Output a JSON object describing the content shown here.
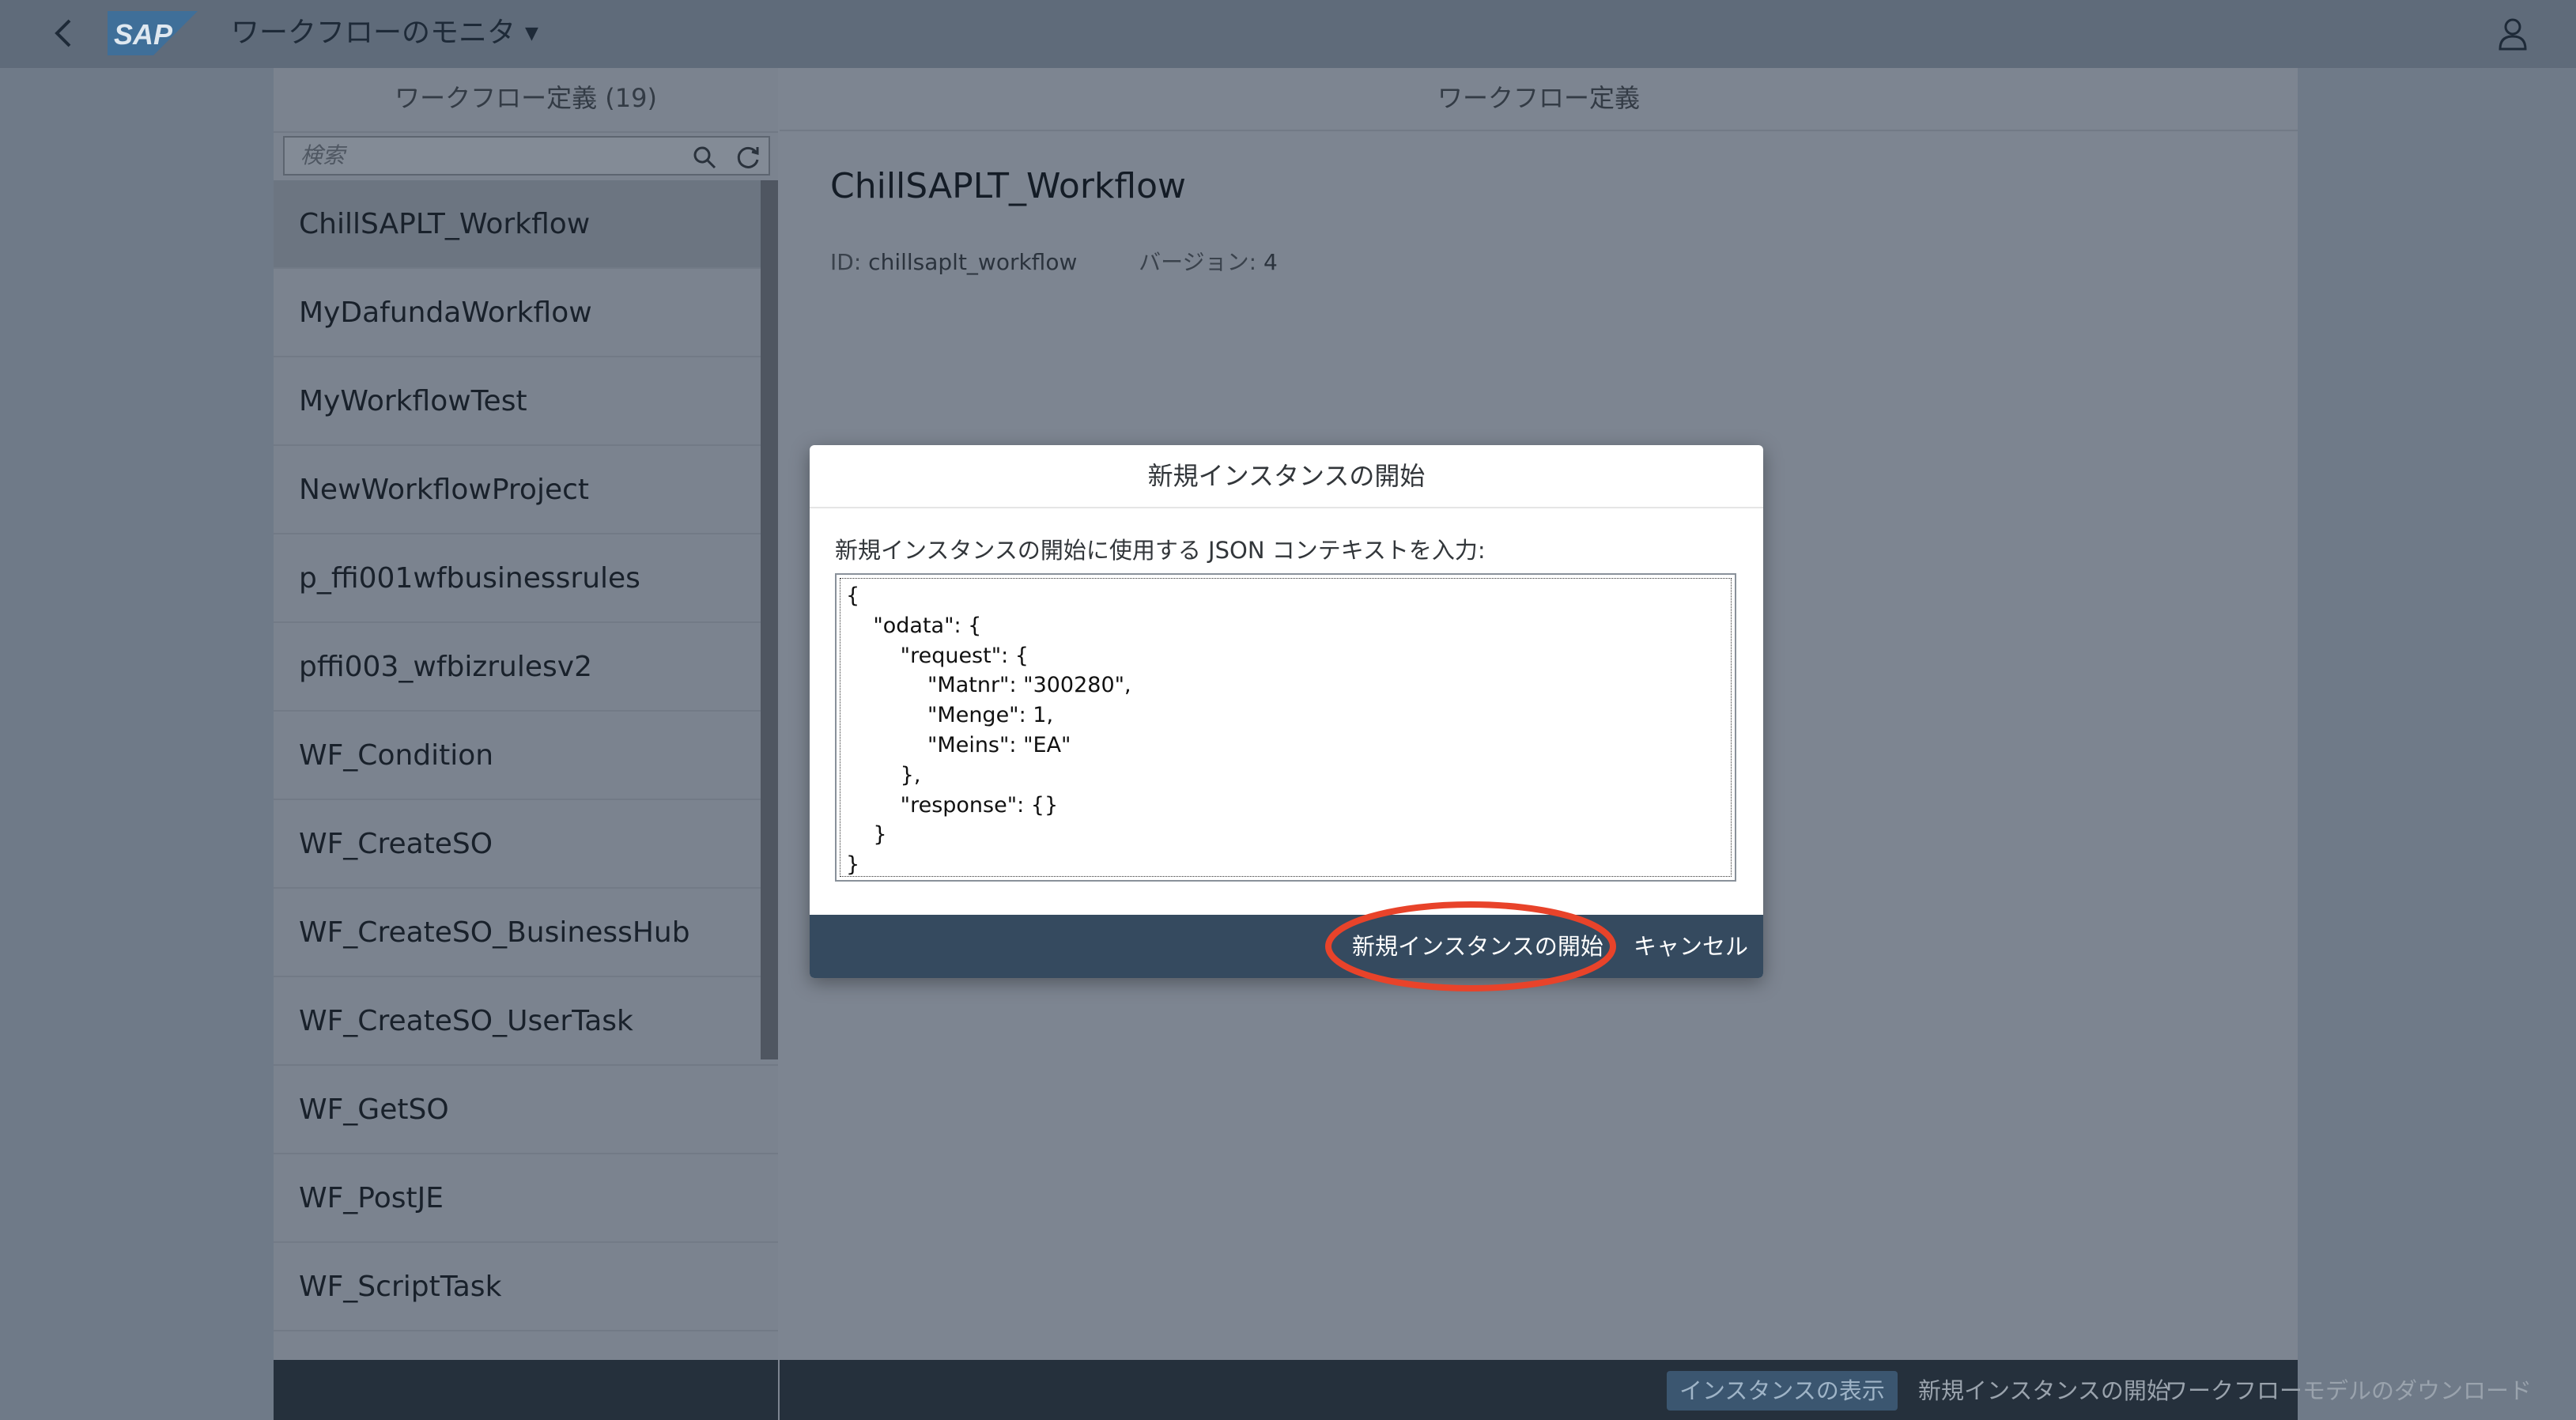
{
  "shell": {
    "title": "ワークフローのモニタ",
    "logo_text": "SAP",
    "back_icon": "chevron-left-icon",
    "user_icon": "user-icon"
  },
  "master": {
    "header": "ワークフロー定義 (19)",
    "search_placeholder": "検索",
    "items": [
      {
        "label": "ChillSAPLT_Workflow",
        "selected": true
      },
      {
        "label": "MyDafundaWorkflow"
      },
      {
        "label": "MyWorkflowTest"
      },
      {
        "label": "NewWorkflowProject"
      },
      {
        "label": "p_ffi001wfbusinessrules"
      },
      {
        "label": "pffi003_wfbizrulesv2"
      },
      {
        "label": "WF_Condition"
      },
      {
        "label": "WF_CreateSO"
      },
      {
        "label": "WF_CreateSO_BusinessHub"
      },
      {
        "label": "WF_CreateSO_UserTask"
      },
      {
        "label": "WF_GetSO"
      },
      {
        "label": "WF_PostJE"
      },
      {
        "label": "WF_ScriptTask"
      }
    ]
  },
  "detail": {
    "header": "ワークフロー定義",
    "title": "ChillSAPLT_Workflow",
    "id_label": "ID:",
    "id_value": "chillsaplt_workflow",
    "version_label": "バージョン:",
    "version_value": "4"
  },
  "footer": {
    "show_instances": "インスタンスの表示",
    "start_new_instance": "新規インスタンスの開始",
    "download_model": "ワークフローモデルのダウンロード"
  },
  "dialog": {
    "title": "新規インスタンスの開始",
    "label": "新規インスタンスの開始に使用する JSON コンテキストを入力:",
    "json_lines": [
      "{",
      "    \"odata\": {",
      "        \"request\": {",
      "            \"Matnr\": \"300280\",",
      "            \"Menge\": 1,",
      "            \"Meins\": \"EA\"",
      "        },",
      "        \"response\": {}",
      "    }",
      "}"
    ],
    "start_button": "新規インスタンスの開始",
    "cancel_button": "キャンセル"
  },
  "colors": {
    "brand_blue": "#0a6ed1",
    "dialog_footer": "#354a5f",
    "highlight_ring": "#e8432a"
  }
}
